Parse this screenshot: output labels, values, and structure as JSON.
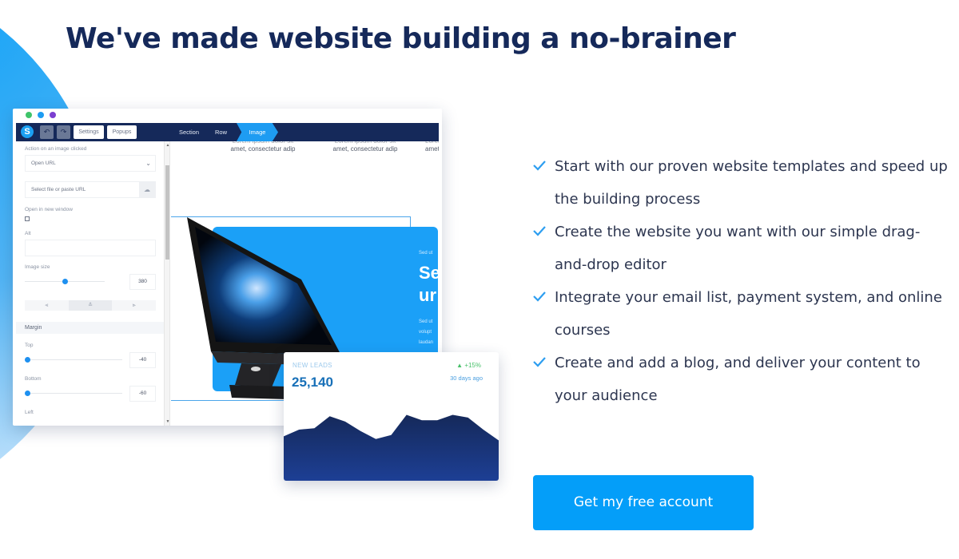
{
  "headline": "We've made website building a no-brainer",
  "editor": {
    "window_dots": [
      "#3fc46a",
      "#1e9cf2",
      "#7b3fd0"
    ],
    "toolbar": {
      "logo": "S",
      "undo_icon": "↶",
      "redo_icon": "↷",
      "settings_label": "Settings",
      "popups_label": "Popups",
      "breadcrumbs": [
        "Section",
        "Row",
        "Image"
      ],
      "active_crumb": "Image"
    },
    "panel": {
      "action_label": "Action on an image clicked",
      "action_value": "Open URL",
      "url_placeholder": "Select file or paste URL",
      "new_window_label": "Open in new window",
      "new_window_checked": false,
      "alt_label": "Alt",
      "alt_value": "",
      "image_size_label": "Image size",
      "image_size_value": "380",
      "image_size_slider": 0.5,
      "align_options": [
        "align-left",
        "align-center",
        "align-right"
      ],
      "align_active": "align-center",
      "margin_heading": "Margin",
      "top_label": "Top",
      "top_value": "-40",
      "bottom_label": "Bottom",
      "bottom_value": "-60",
      "left_label": "Left"
    },
    "canvas": {
      "lorem_line1": "Lorem ipsum dolor sit",
      "lorem_line2": "amet, consectetur adip",
      "card_eyebrow": "Sed ut",
      "card_title_1": "Se",
      "card_title_2": "ur",
      "card_body": [
        "Sed ut",
        "volupt",
        "laudan"
      ]
    }
  },
  "leads_card": {
    "label": "NEW LEADS",
    "value": "25,140",
    "change": "+15%",
    "period": "30 days ago",
    "trend_icon": "triangle-up"
  },
  "chart_data": {
    "type": "area",
    "title": "NEW LEADS",
    "x": [
      0,
      1,
      2,
      3,
      4,
      5,
      6,
      7,
      8,
      9,
      10,
      11,
      12,
      13,
      14
    ],
    "values": [
      33,
      38,
      39,
      48,
      44,
      37,
      31,
      34,
      49,
      45,
      45,
      49,
      47,
      38,
      30
    ],
    "ylim": [
      0,
      60
    ],
    "grid": false,
    "color_top": "#15295a",
    "color_bottom": "#1d3f95"
  },
  "features": [
    "Start with our proven website templates and speed up the building process",
    "Create the website you want with our simple drag-and-drop editor",
    "Integrate your email list, payment system, and online courses",
    "Create and add a blog, and deliver your content to your audience"
  ],
  "cta": {
    "label": "Get my free account"
  },
  "colors": {
    "accent": "#049ef9",
    "navy": "#15295a",
    "check": "#2d9ef0"
  }
}
